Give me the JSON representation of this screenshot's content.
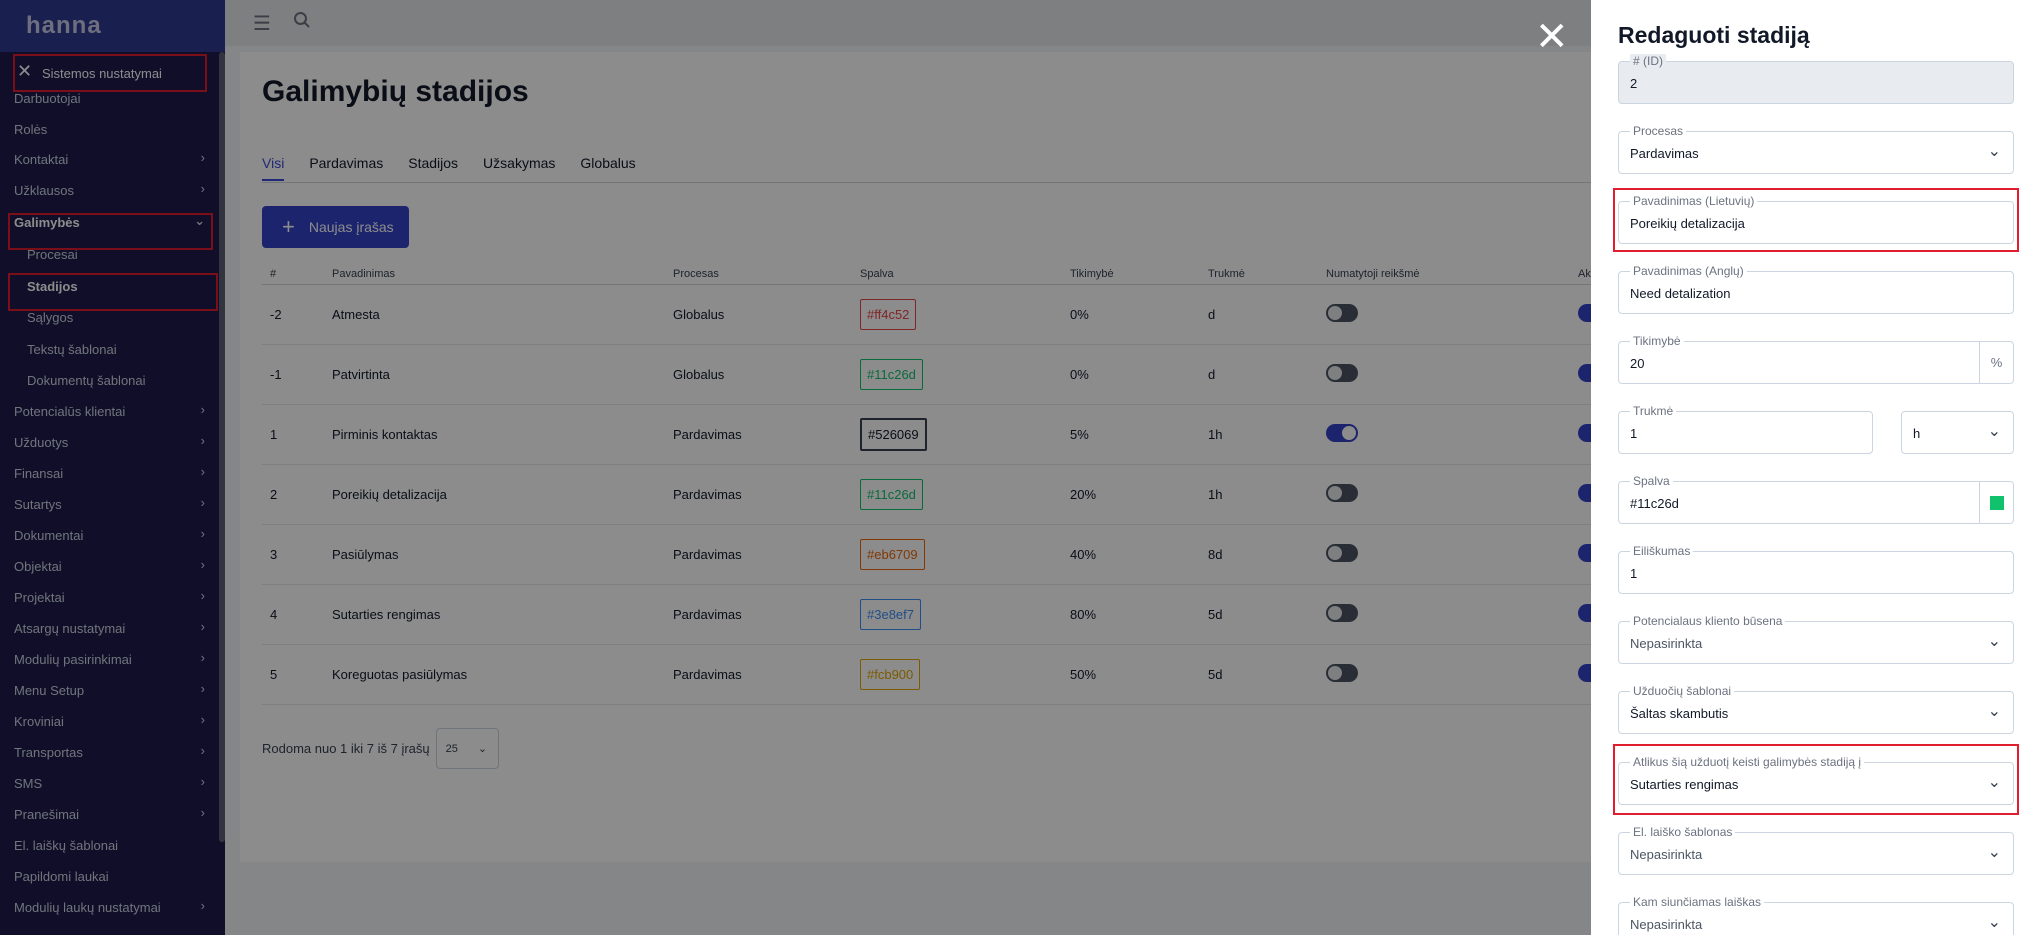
{
  "app": {
    "logo": "hanna"
  },
  "sidebar": {
    "header": "Sistemos nustatymai",
    "items": [
      {
        "label": "Darbuotojai",
        "sub": false,
        "chevron": false
      },
      {
        "label": "Rolės",
        "sub": false,
        "chevron": false
      },
      {
        "label": "Kontaktai",
        "sub": false,
        "chevron": true
      },
      {
        "label": "Užklausos",
        "sub": false,
        "chevron": true
      },
      {
        "label": "Galimybės",
        "sub": false,
        "chevron": true,
        "expanded": true
      },
      {
        "label": "Procesai",
        "sub": true,
        "chevron": false
      },
      {
        "label": "Stadijos",
        "sub": true,
        "chevron": false,
        "active": true
      },
      {
        "label": "Sąlygos",
        "sub": true,
        "chevron": false
      },
      {
        "label": "Tekstų šablonai",
        "sub": true,
        "chevron": false
      },
      {
        "label": "Dokumentų šablonai",
        "sub": true,
        "chevron": false
      },
      {
        "label": "Potencialūs klientai",
        "sub": false,
        "chevron": true
      },
      {
        "label": "Užduotys",
        "sub": false,
        "chevron": true
      },
      {
        "label": "Finansai",
        "sub": false,
        "chevron": true
      },
      {
        "label": "Sutartys",
        "sub": false,
        "chevron": true
      },
      {
        "label": "Dokumentai",
        "sub": false,
        "chevron": true
      },
      {
        "label": "Objektai",
        "sub": false,
        "chevron": true
      },
      {
        "label": "Projektai",
        "sub": false,
        "chevron": true
      },
      {
        "label": "Atsargų nustatymai",
        "sub": false,
        "chevron": true
      },
      {
        "label": "Modulių pasirinkimai",
        "sub": false,
        "chevron": true
      },
      {
        "label": "Menu Setup",
        "sub": false,
        "chevron": true
      },
      {
        "label": "Kroviniai",
        "sub": false,
        "chevron": true
      },
      {
        "label": "Transportas",
        "sub": false,
        "chevron": true
      },
      {
        "label": "SMS",
        "sub": false,
        "chevron": true
      },
      {
        "label": "Pranešimai",
        "sub": false,
        "chevron": true
      },
      {
        "label": "El. laiškų šablonai",
        "sub": false,
        "chevron": false
      },
      {
        "label": "Papildomi laukai",
        "sub": false,
        "chevron": false
      },
      {
        "label": "Modulių laukų nustatymai",
        "sub": false,
        "chevron": true
      }
    ]
  },
  "page": {
    "title": "Galimybių stadijos",
    "tabs": [
      "Visi",
      "Pardavimas",
      "Stadijos",
      "Užsakymas",
      "Globalus"
    ],
    "active_tab": "Visi",
    "new_button": "Naujas įrašas",
    "columns": [
      "#",
      "Pavadinimas",
      "Procesas",
      "Spalva",
      "Tikimybė",
      "Trukmė",
      "Numatytoji reikšmė",
      "Ak"
    ],
    "rows": [
      {
        "id": "-2",
        "name": "Atmesta",
        "process": "Globalus",
        "color": "#ff4c52",
        "chip_color": "#e8454b",
        "probability": "0%",
        "duration": "d",
        "default": false
      },
      {
        "id": "-1",
        "name": "Patvirtinta",
        "process": "Globalus",
        "color": "#11c26d",
        "chip_color": "#11c26d",
        "probability": "0%",
        "duration": "d",
        "default": false
      },
      {
        "id": "1",
        "name": "Pirminis kontaktas",
        "process": "Pardavimas",
        "color": "#526069",
        "chip_color": "#526069",
        "probability": "5%",
        "duration": "1h",
        "default": true
      },
      {
        "id": "2",
        "name": "Poreikių detalizacija",
        "process": "Pardavimas",
        "color": "#11c26d",
        "chip_color": "#11c26d",
        "probability": "20%",
        "duration": "1h",
        "default": false
      },
      {
        "id": "3",
        "name": "Pasiūlymas",
        "process": "Pardavimas",
        "color": "#eb6709",
        "chip_color": "#eb6709",
        "probability": "40%",
        "duration": "8d",
        "default": false
      },
      {
        "id": "4",
        "name": "Sutarties rengimas",
        "process": "Pardavimas",
        "color": "#3e8ef7",
        "chip_color": "#3e8ef7",
        "probability": "80%",
        "duration": "5d",
        "default": false
      },
      {
        "id": "5",
        "name": "Koreguotas pasiūlymas",
        "process": "Pardavimas",
        "color": "#fcb900",
        "chip_color": "#e0a500",
        "probability": "50%",
        "duration": "5d",
        "default": false
      }
    ],
    "paging_text": "Rodoma nuo 1 iki 7 iš 7 įrašų",
    "page_size": "25"
  },
  "drawer": {
    "title": "Redaguoti stadiją",
    "id_label": "# (ID)",
    "id_value": "2",
    "process_label": "Procesas",
    "process_value": "Pardavimas",
    "name_lt_label": "Pavadinimas (Lietuvių)",
    "name_lt_value": "Poreikių detalizacija",
    "name_en_label": "Pavadinimas (Anglų)",
    "name_en_value": "Need detalization",
    "probability_label": "Tikimybė",
    "probability_value": "20",
    "probability_suffix": "%",
    "duration_label": "Trukmė",
    "duration_value": "1",
    "duration_unit": "h",
    "color_label": "Spalva",
    "color_value": "#11c26d",
    "order_label": "Eiliškumas",
    "order_value": "1",
    "lead_status_label": "Potencialaus kliento būsena",
    "lead_status_value": "Nepasirinkta",
    "task_template_label": "Užduočių šablonai",
    "task_template_value": "Šaltas skambutis",
    "next_stage_label": "Atlikus šią užduotį keisti galimybės stadiją į",
    "next_stage_value": "Sutarties rengimas",
    "email_template_label": "El. laiško šablonas",
    "email_template_value": "Nepasirinkta",
    "recipient_label": "Kam siunčiamas laiškas",
    "recipient_value": "Nepasirinkta"
  },
  "icons": {
    "menu": "menu-icon",
    "search": "search-icon",
    "close": "close-icon",
    "chevron": "chevron-down-icon"
  }
}
